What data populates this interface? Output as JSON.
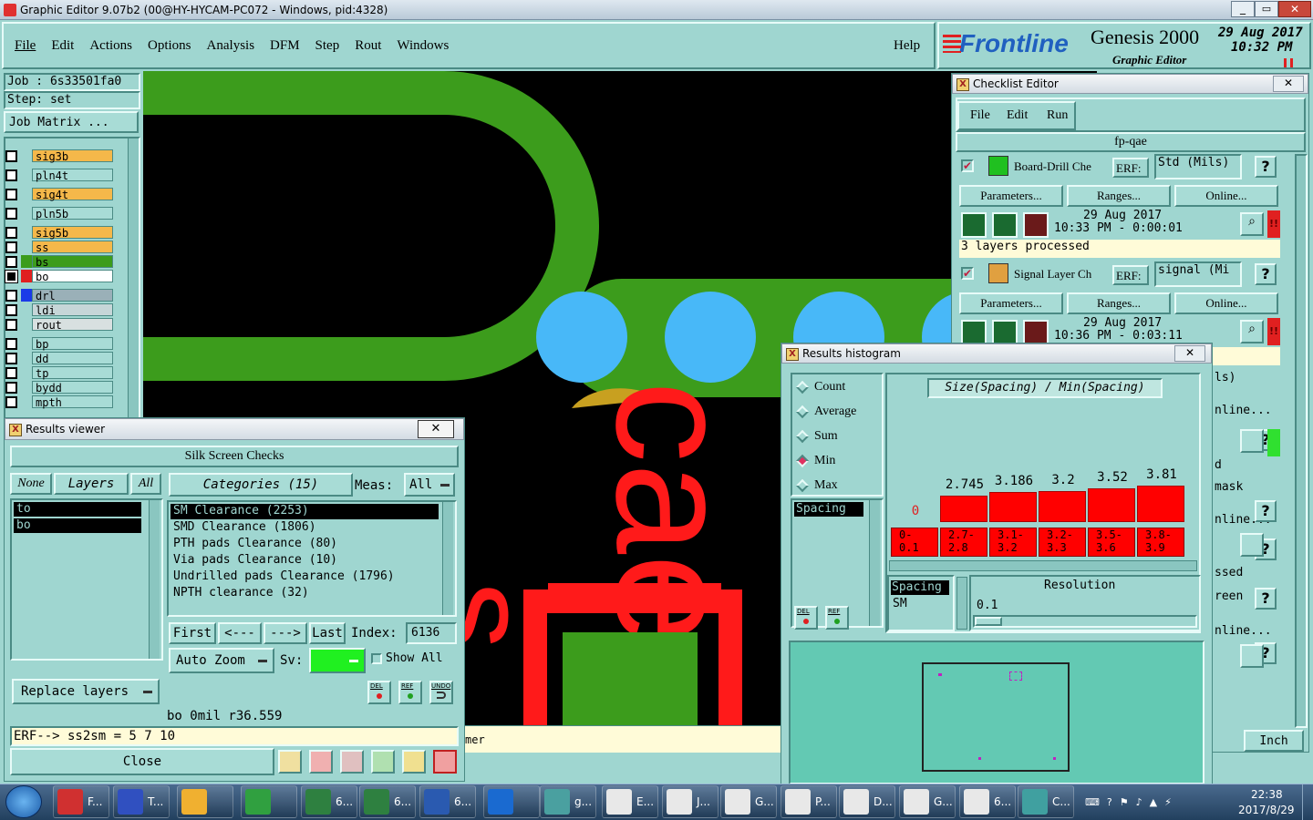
{
  "window": {
    "title": "Graphic Editor 9.07b2 (00@HY-HYCAM-PC072 - Windows, pid:4328)"
  },
  "menu": {
    "items": [
      "File",
      "Edit",
      "Actions",
      "Options",
      "Analysis",
      "DFM",
      "Step",
      "Rout",
      "Windows"
    ],
    "help": "Help"
  },
  "brand": {
    "logo": "Frontline",
    "product": "Genesis 2000",
    "subtitle": "Graphic Editor",
    "date": "29 Aug 2017",
    "time": "10:32 PM"
  },
  "job": {
    "job_label": "Job : 6s33501fa0",
    "step_label": "Step: set",
    "matrix_button": "Job Matrix ..."
  },
  "layers": [
    {
      "name": "sig3b",
      "color": "#f5b84a"
    },
    {
      "name": "pln4t",
      "color": "#a8dcd6"
    },
    {
      "name": "sig4t",
      "color": "#f5b84a"
    },
    {
      "name": "pln5b",
      "color": "#a8dcd6"
    },
    {
      "name": "sig5b",
      "color": "#f5b84a"
    },
    {
      "name": "ss",
      "color": "#f5b84a"
    },
    {
      "name": "bs",
      "color": "#3c9c1c"
    },
    {
      "name": "bo",
      "color": "#ffffff"
    },
    {
      "name": "drl",
      "color": "#9ab0b8"
    },
    {
      "name": "ldi",
      "color": "#c6d6d8"
    },
    {
      "name": "rout",
      "color": "#d8e0e0"
    },
    {
      "name": "bp",
      "color": "#a8dcd6"
    },
    {
      "name": "dd",
      "color": "#a8dcd6"
    },
    {
      "name": "tp",
      "color": "#a8dcd6"
    },
    {
      "name": "bydd",
      "color": "#a8dcd6"
    },
    {
      "name": "mpth",
      "color": "#a8dcd6"
    }
  ],
  "checklist": {
    "title": "Checklist Editor",
    "menu": [
      "File",
      "Edit",
      "Run"
    ],
    "name": "fp-qae",
    "erf_label": "ERF:",
    "parameters": "Parameters...",
    "ranges": "Ranges...",
    "online": "Online...",
    "checks": [
      {
        "name": "Board-Drill Che",
        "erf": "Std (Mils)",
        "date": "29 Aug 2017",
        "time": "10:33 PM - 0:00:01",
        "status": "3 layers processed"
      },
      {
        "name": "Signal Layer Ch",
        "erf": "signal (Mi",
        "date": "29 Aug 2017",
        "time": "10:36 PM - 0:03:11",
        "status": ""
      }
    ],
    "partial": [
      "ls)",
      "nline...",
      "d",
      "mask",
      "nline...",
      "ssed",
      "reen",
      "nline..."
    ],
    "units": "Inch"
  },
  "results_viewer": {
    "title": "Results viewer",
    "header": "Silk Screen Checks",
    "none": "None",
    "layers": "Layers",
    "all": "All",
    "categories_label": "Categories (15)",
    "meas_label": "Meas:",
    "meas_value": "All",
    "layer_list": [
      "to",
      "bo"
    ],
    "categories": [
      "SM Clearance (2253)",
      "SMD Clearance (1806)",
      "PTH pads Clearance (80)",
      "Via pads Clearance (10)",
      "Undrilled pads Clearance (1796)",
      "NPTH clearance (32)"
    ],
    "nav": {
      "first": "First",
      "prev": "<---",
      "next": "--->",
      "last": "Last",
      "index_label": "Index:",
      "index_value": "6136"
    },
    "auto_zoom": "Auto Zoom",
    "sv_label": "Sv:",
    "show_all": "Show All",
    "replace_layers": "Replace layers",
    "info": "bo 0mil r36.559",
    "erf_line": "ERF--> ss2sm = 5 7 10",
    "close": "Close",
    "icon_labels": {
      "del": "DEL",
      "ref": "REF",
      "undo": "UNDO"
    }
  },
  "histogram": {
    "title": "Results histogram",
    "modes": [
      {
        "label": "Count",
        "selected": false
      },
      {
        "label": "Average",
        "selected": false
      },
      {
        "label": "Sum",
        "selected": false
      },
      {
        "label": "Min",
        "selected": true
      },
      {
        "label": "Max",
        "selected": false
      }
    ],
    "list_item": "Spacing",
    "chart_title": "Size(Spacing) / Min(Spacing)",
    "bins": [
      {
        "range_top": "0-",
        "range_bot": "0.1",
        "value": "0"
      },
      {
        "range_top": "2.7-",
        "range_bot": "2.8",
        "value": "2.745"
      },
      {
        "range_top": "3.1-",
        "range_bot": "3.2",
        "value": "3.186"
      },
      {
        "range_top": "3.2-",
        "range_bot": "3.3",
        "value": "3.2"
      },
      {
        "range_top": "3.5-",
        "range_bot": "3.6",
        "value": "3.52"
      },
      {
        "range_top": "3.8-",
        "range_bot": "3.9",
        "value": "3.81"
      }
    ],
    "legend_line1": "Spacing",
    "legend_line2": "SM",
    "resolution_label": "Resolution",
    "resolution_value": "0.1",
    "icon_labels": {
      "del": "DEL",
      "ref": "REF"
    }
  },
  "canvas": {
    "status_fragment": "mer"
  },
  "taskbar": {
    "items": [
      "F...",
      "T...",
      "",
      "",
      "6...",
      "6...",
      "6...",
      "",
      "g...",
      "E...",
      "J...",
      "G...",
      "P...",
      "D...",
      "G...",
      "6...",
      "C..."
    ],
    "time": "22:38",
    "date": "2017/8/29"
  }
}
